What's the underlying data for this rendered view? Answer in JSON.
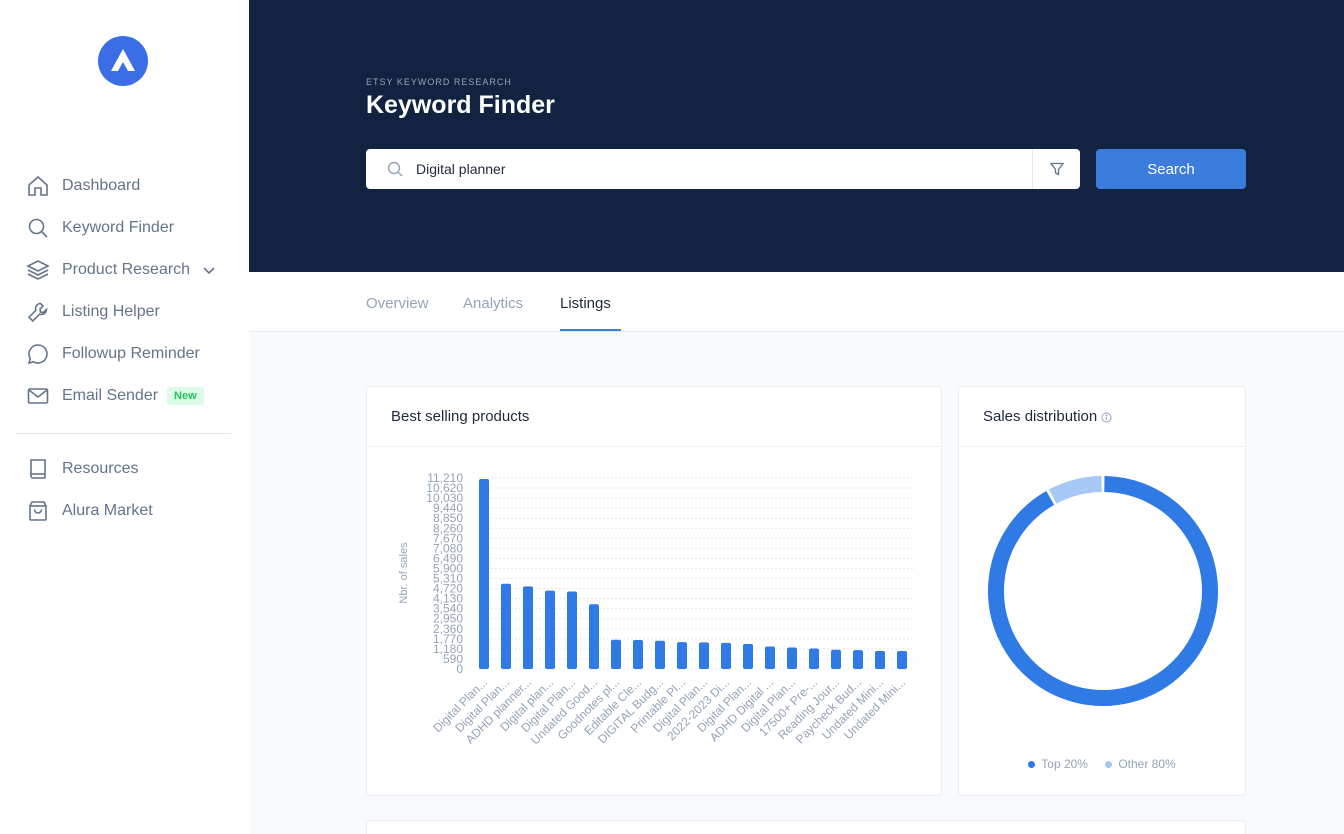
{
  "sidebar": {
    "items": [
      {
        "label": "Dashboard",
        "icon": "home-icon"
      },
      {
        "label": "Keyword Finder",
        "icon": "search-icon"
      },
      {
        "label": "Product Research",
        "icon": "layers-icon"
      },
      {
        "label": "Listing Helper",
        "icon": "wrench-icon"
      },
      {
        "label": "Followup Reminder",
        "icon": "chat-icon"
      },
      {
        "label": "Email Sender",
        "icon": "mail-icon",
        "badge": "New"
      },
      {
        "label": "Resources",
        "icon": "book-icon"
      },
      {
        "label": "Alura Market",
        "icon": "bag-icon"
      }
    ]
  },
  "header": {
    "eyebrow": "ETSY KEYWORD RESEARCH",
    "title": "Keyword Finder",
    "search_value": "Digital planner",
    "search_button": "Search"
  },
  "tabs": [
    {
      "label": "Overview"
    },
    {
      "label": "Analytics"
    },
    {
      "label": "Listings",
      "active": true
    }
  ],
  "best_selling": {
    "title": "Best selling products"
  },
  "sales_distribution": {
    "title": "Sales distribution",
    "legend": [
      "Top 20%",
      "Other 80%"
    ]
  },
  "colors": {
    "accent": "#3b7ddd",
    "hero": "#122341",
    "pie_top": "#2f7ae5",
    "pie_other": "#a5c8f5"
  },
  "chart_data": [
    {
      "type": "bar",
      "ylabel": "Nbr. of sales",
      "ylim": [
        0,
        11210
      ],
      "yticks": [
        "0",
        "590",
        "1,180",
        "1,770",
        "2,360",
        "2,950",
        "3,540",
        "4,130",
        "4,720",
        "5,310",
        "5,900",
        "6,490",
        "7,080",
        "7,670",
        "8,260",
        "8,850",
        "9,440",
        "10,030",
        "10,620",
        "11,210"
      ],
      "categories": [
        "Digital Plan...",
        "Digital Plan...",
        "ADHD planner...",
        "Digital plan...",
        "Digital Plan...",
        "Undated Good...",
        "Goodnotes pl...",
        "Editable Cle...",
        "DIGITAL Budg...",
        "Printable Pl...",
        "Digital Plan...",
        "2022-2023 Di...",
        "Digital Plan...",
        "ADHD Digital ...",
        "Digital Plan...",
        "17500+ Pre-...",
        "Reading Jour...",
        "Paycheck Bud...",
        "Undated Mini...",
        "Undated Mini..."
      ],
      "values": [
        11150,
        5000,
        4850,
        4600,
        4550,
        3800,
        1720,
        1700,
        1660,
        1580,
        1560,
        1530,
        1470,
        1320,
        1260,
        1200,
        1130,
        1110,
        1060,
        1060
      ],
      "grid": true
    },
    {
      "type": "pie",
      "donut": true,
      "labels": [
        "Top 20%",
        "Other 80%"
      ],
      "values": [
        92,
        8
      ]
    }
  ]
}
